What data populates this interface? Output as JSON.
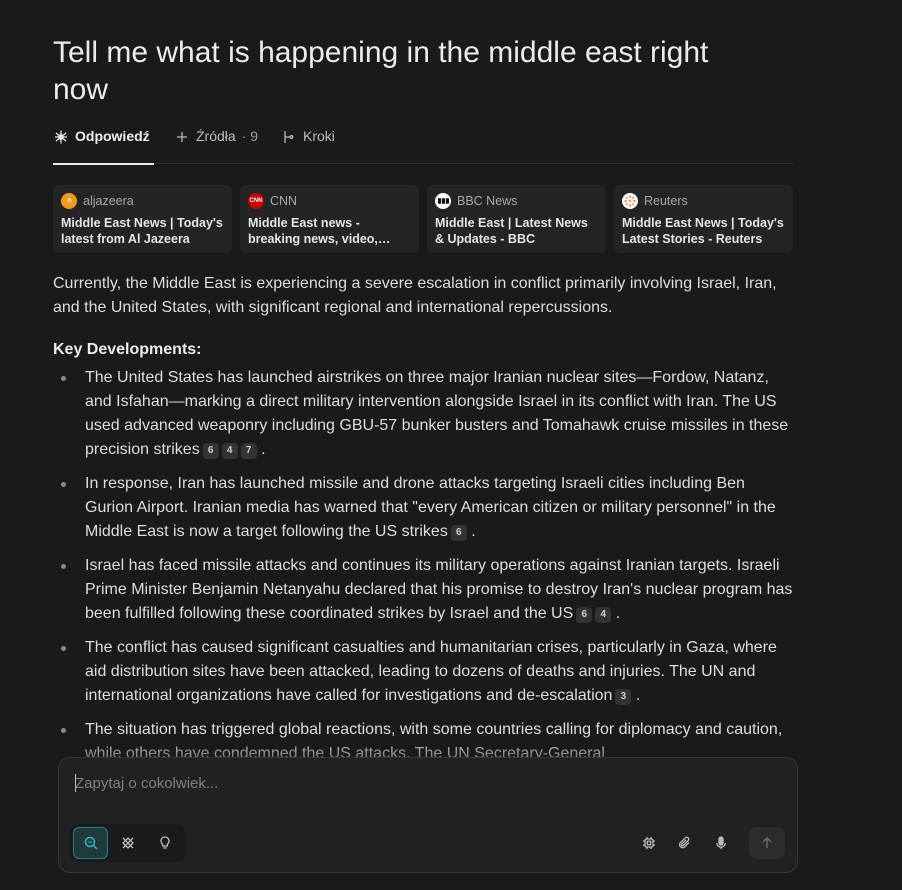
{
  "title": "Tell me what is happening in the middle east right now",
  "tabs": [
    {
      "label": "Odpowiedź",
      "icon": "answer-icon",
      "active": true
    },
    {
      "label": "Źródła",
      "count": "· 9",
      "icon": "sources-icon",
      "active": false
    },
    {
      "label": "Kroki",
      "icon": "steps-icon",
      "active": false
    }
  ],
  "sources": [
    {
      "site": "aljazeera",
      "title": "Middle East News | Today's latest from Al Jazeera",
      "favicon_color": "#f39a1e",
      "favicon_text": ""
    },
    {
      "site": "CNN",
      "title": "Middle East news - breaking news, video, headlines and op-eds",
      "favicon_color": "#cc0000",
      "favicon_text": "CNN"
    },
    {
      "site": "BBC News",
      "title": "Middle East | Latest News & Updates - BBC",
      "favicon_color": "#ffffff",
      "favicon_text": "BBC"
    },
    {
      "site": "Reuters",
      "title": "Middle East News | Today's Latest Stories - Reuters",
      "favicon_color": "#fb8033",
      "favicon_text": ""
    }
  ],
  "answer": {
    "intro": "Currently, the Middle East is experiencing a severe escalation in conflict primarily involving Israel, Iran, and the United States, with significant regional and international repercussions.",
    "heading": "Key Developments:",
    "bullets": [
      {
        "text": "The United States has launched airstrikes on three major Iranian nuclear sites—Fordow, Natanz, and Isfahan—marking a direct military intervention alongside Israel in its conflict with Iran. The US used advanced weaponry including GBU-57 bunker busters and Tomahawk cruise missiles in these precision strikes",
        "c1": "6",
        "c2": "4",
        "c3": "7"
      },
      {
        "text": "In response, Iran has launched missile and drone attacks targeting Israeli cities including Ben Gurion Airport. Iranian media has warned that \"every American citizen or military personnel\" in the Middle East is now a target following the US strikes",
        "c1": "6"
      },
      {
        "text": "Israel has faced missile attacks and continues its military operations against Iranian targets. Israeli Prime Minister Benjamin Netanyahu declared that his promise to destroy Iran's nuclear program has been fulfilled following these coordinated strikes by Israel and the US",
        "c1": "6",
        "c2": "4"
      },
      {
        "text": "The conflict has caused significant casualties and humanitarian crises, particularly in Gaza, where aid distribution sites have been attacked, leading to dozens of deaths and injuries. The UN and international organizations have called for investigations and de-escalation",
        "c1": "3"
      },
      {
        "text": "The situation has triggered global reactions, with some countries calling for diplomacy and caution, while others have condemned the US attacks. The UN Secretary-General"
      }
    ]
  },
  "composer": {
    "placeholder": "Zapytaj o cokolwiek...",
    "modes": [
      {
        "icon": "search-icon",
        "active": true
      },
      {
        "icon": "research-icon",
        "active": false
      },
      {
        "icon": "lightbulb-icon",
        "active": false
      }
    ],
    "tools": [
      "cpu-chip-icon",
      "paperclip-icon",
      "microphone-icon"
    ],
    "send_icon": "arrow-up-icon",
    "accent": "#2a7f86"
  }
}
